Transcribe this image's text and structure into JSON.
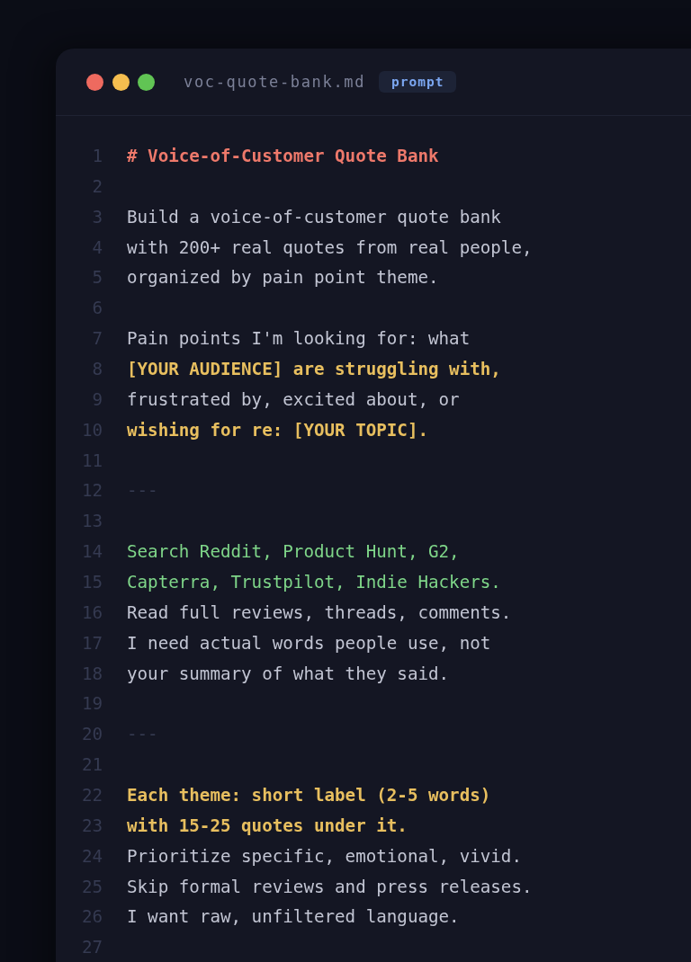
{
  "window": {
    "title": "voc-quote-bank.md",
    "badge": "prompt"
  },
  "lines": [
    {
      "number": "1",
      "kind": "heading",
      "text": "# Voice-of-Customer Quote Bank"
    },
    {
      "number": "2",
      "kind": "blank"
    },
    {
      "number": "3",
      "kind": "body",
      "text": "Build a voice-of-customer quote bank"
    },
    {
      "number": "4",
      "kind": "body",
      "text": "with 200+ real quotes from real people,"
    },
    {
      "number": "5",
      "kind": "body",
      "text": "organized by pain point theme."
    },
    {
      "number": "6",
      "kind": "blank"
    },
    {
      "number": "7",
      "kind": "body",
      "text": "Pain points I'm looking for: what"
    },
    {
      "number": "8",
      "kind": "emphasis",
      "text": "[YOUR AUDIENCE] are struggling with,"
    },
    {
      "number": "9",
      "kind": "body",
      "text": "frustrated by, excited about, or"
    },
    {
      "number": "10",
      "kind": "emphasis",
      "text": "wishing for re: [YOUR TOPIC]."
    },
    {
      "number": "11",
      "kind": "blank"
    },
    {
      "number": "12",
      "kind": "rule",
      "text": "---"
    },
    {
      "number": "13",
      "kind": "blank"
    },
    {
      "number": "14",
      "kind": "accent",
      "text": "Search Reddit, Product Hunt, G2,"
    },
    {
      "number": "15",
      "kind": "accent",
      "text": "Capterra, Trustpilot, Indie Hackers."
    },
    {
      "number": "16",
      "kind": "body",
      "text": "Read full reviews, threads, comments."
    },
    {
      "number": "17",
      "kind": "body",
      "text": "I need actual words people use, not"
    },
    {
      "number": "18",
      "kind": "body",
      "text": "your summary of what they said."
    },
    {
      "number": "19",
      "kind": "blank"
    },
    {
      "number": "20",
      "kind": "rule",
      "text": "---"
    },
    {
      "number": "21",
      "kind": "blank"
    },
    {
      "number": "22",
      "kind": "emphasis",
      "text": "Each theme: short label (2-5 words)"
    },
    {
      "number": "23",
      "kind": "emphasis",
      "text": "with 15-25 quotes under it."
    },
    {
      "number": "24",
      "kind": "body",
      "text": "Prioritize specific, emotional, vivid."
    },
    {
      "number": "25",
      "kind": "body",
      "text": "Skip formal reviews and press releases."
    },
    {
      "number": "26",
      "kind": "body",
      "text": "I want raw, unfiltered language."
    },
    {
      "number": "27",
      "kind": "blank"
    }
  ]
}
